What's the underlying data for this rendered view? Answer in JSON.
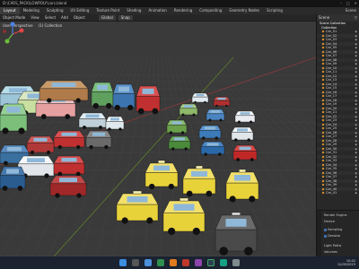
{
  "window": {
    "title": "D:\\CARS_PACK\\LOWPOLY\\cars.blend"
  },
  "menubar": {
    "tabs": [
      "Layout",
      "Modeling",
      "Sculpting",
      "UV Editing",
      "Texture Paint",
      "Shading",
      "Animation",
      "Rendering",
      "Compositing",
      "Geometry Nodes",
      "Scripting"
    ],
    "active_index": 0,
    "scene_label": "Scene"
  },
  "header": {
    "left_items": [
      "Object Mode",
      "View",
      "Select",
      "Add",
      "Object"
    ],
    "transform_chip": "Global",
    "pivot_chip": "Snap"
  },
  "viewport": {
    "label_view": "User Perspective",
    "label_collection": "(1) Collection"
  },
  "outliner": {
    "title": "Scene Collection",
    "collection_label": "Collection",
    "items": [
      "Car_01",
      "Car_02",
      "Car_03",
      "Car_04",
      "Car_05",
      "Car_06",
      "Car_07",
      "Car_08",
      "Car_09",
      "Car_10",
      "Car_11",
      "Car_12",
      "Car_13",
      "Car_14",
      "Car_15",
      "Car_16",
      "Car_17",
      "Car_18",
      "Car_19",
      "Car_20",
      "Car_21",
      "Car_22",
      "Car_23",
      "Car_24",
      "Car_25",
      "Car_26",
      "Car_27",
      "Car_28",
      "Car_29",
      "Car_30",
      "Car_31",
      "Car_32",
      "Car_33",
      "Car_34",
      "Car_35",
      "Car_36",
      "Car_37",
      "Car_38",
      "Car_39",
      "Car_40",
      "Car_41"
    ]
  },
  "properties": {
    "row1": "Render Engine",
    "row2": "Device",
    "row3": "Sampling",
    "row4": "Denoise",
    "row5": "Light Paths",
    "row6": "Volumes"
  },
  "taskbar": {
    "time": "10:42",
    "date": "12/05/2023"
  },
  "colors": {
    "accent": "#f0a030",
    "viewport_bg": "#3a3a3a",
    "taxi_yellow": "#e8d23a"
  }
}
